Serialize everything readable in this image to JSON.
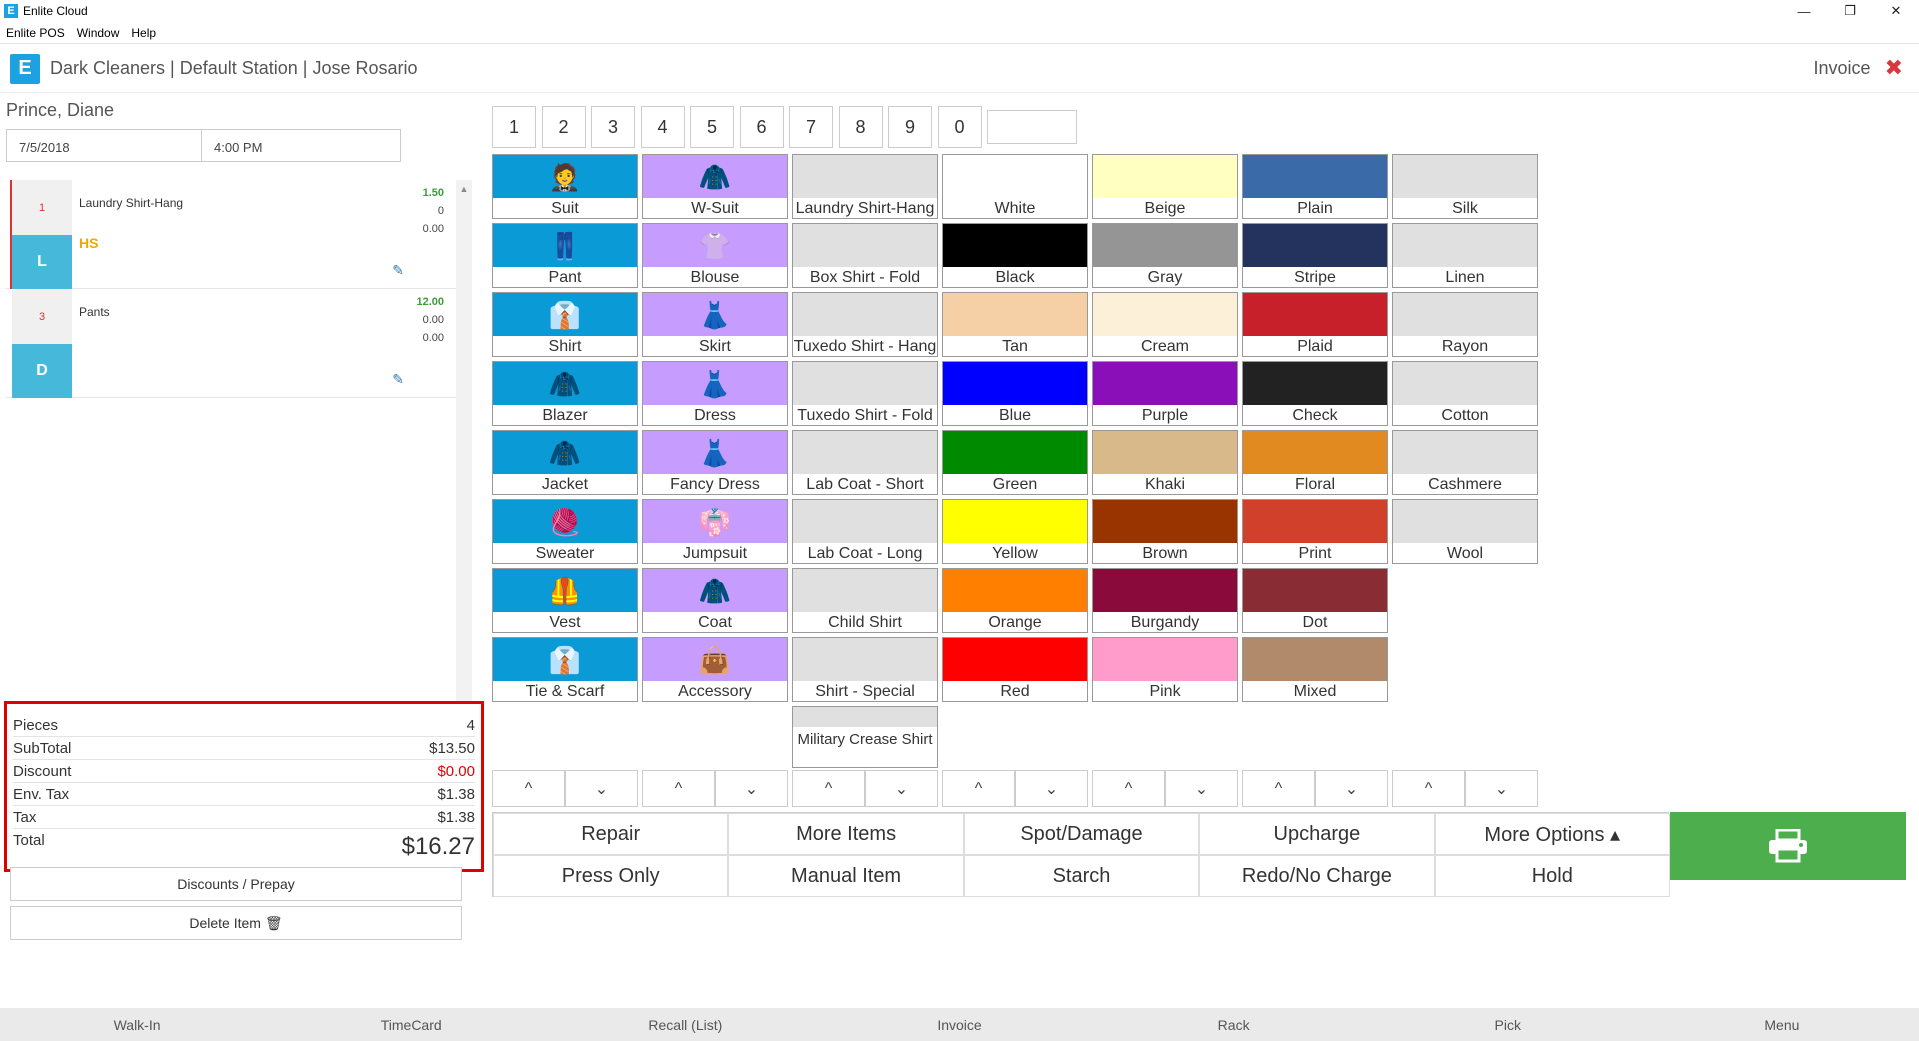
{
  "window": {
    "title": "Enlite Cloud",
    "logo_letter": "E",
    "minimize": "—",
    "restore": "❐",
    "close": "✕"
  },
  "menu": [
    "Enlite POS",
    "Window",
    "Help"
  ],
  "header": {
    "title": "Dark Cleaners | Default Station | Jose Rosario",
    "right_label": "Invoice",
    "close_glyph": "✖"
  },
  "customer": {
    "name": "Prince, Diane",
    "date": "7/5/2018",
    "time": "4:00 PM"
  },
  "items": [
    {
      "qty": "1",
      "name": "Laundry Shirt-Hang",
      "price": "1.50",
      "line2": "0",
      "line3": "0.00",
      "code": "L",
      "tag": "HS"
    },
    {
      "qty": "3",
      "name": "Pants",
      "price": "12.00",
      "line2": "0.00",
      "line3": "0.00",
      "code": "D",
      "tag": ""
    }
  ],
  "totals": {
    "pieces_label": "Pieces",
    "pieces": "4",
    "subtotal_label": "SubTotal",
    "subtotal": "$13.50",
    "discount_label": "Discount",
    "discount": "$0.00",
    "envtax_label": "Env. Tax",
    "envtax": "$1.38",
    "tax_label": "Tax",
    "tax": "$1.38",
    "total_label": "Total",
    "total": "$16.27"
  },
  "left_buttons": {
    "discounts": "Discounts / Prepay",
    "delete": "Delete Item 🗑"
  },
  "numpad": [
    "1",
    "2",
    "3",
    "4",
    "5",
    "6",
    "7",
    "8",
    "9",
    "0"
  ],
  "garments": [
    {
      "label": "Suit",
      "icon": "🤵"
    },
    {
      "label": "Pant",
      "icon": "👖"
    },
    {
      "label": "Shirt",
      "icon": "👔"
    },
    {
      "label": "Blazer",
      "icon": "🧥"
    },
    {
      "label": "Jacket",
      "icon": "🧥"
    },
    {
      "label": "Sweater",
      "icon": "🧶"
    },
    {
      "label": "Vest",
      "icon": "🦺"
    },
    {
      "label": "Tie & Scarf",
      "icon": "👔"
    }
  ],
  "womens": [
    {
      "label": "W-Suit",
      "icon": "🧥"
    },
    {
      "label": "Blouse",
      "icon": "👚"
    },
    {
      "label": "Skirt",
      "icon": "👗"
    },
    {
      "label": "Dress",
      "icon": "👗"
    },
    {
      "label": "Fancy Dress",
      "icon": "👗"
    },
    {
      "label": "Jumpsuit",
      "icon": "👘"
    },
    {
      "label": "Coat",
      "icon": "🧥"
    },
    {
      "label": "Accessory",
      "icon": "👜"
    }
  ],
  "shirts": [
    "Laundry Shirt-Hang",
    "Box Shirt - Fold",
    "Tuxedo Shirt - Hang",
    "Tuxedo Shirt - Fold",
    "Lab Coat - Short",
    "Lab Coat - Long",
    "Child Shirt",
    "Shirt - Special",
    "Military Crease Shirt"
  ],
  "colors1": [
    {
      "label": "White",
      "color": "#ffffff"
    },
    {
      "label": "Black",
      "color": "#000000"
    },
    {
      "label": "Tan",
      "color": "#f5cfa6"
    },
    {
      "label": "Blue",
      "color": "#0000ff"
    },
    {
      "label": "Green",
      "color": "#008a00"
    },
    {
      "label": "Yellow",
      "color": "#ffff00"
    },
    {
      "label": "Orange",
      "color": "#ff8000"
    },
    {
      "label": "Red",
      "color": "#ff0000"
    }
  ],
  "colors2": [
    {
      "label": "Beige",
      "color": "#ffffc2"
    },
    {
      "label": "Gray",
      "color": "#959595"
    },
    {
      "label": "Cream",
      "color": "#fdf0d8"
    },
    {
      "label": "Purple",
      "color": "#8a0fb8"
    },
    {
      "label": "Khaki",
      "color": "#d8b98a"
    },
    {
      "label": "Brown",
      "color": "#993300"
    },
    {
      "label": "Burgandy",
      "color": "#8a0a3c"
    },
    {
      "label": "Pink",
      "color": "#ff9ccc"
    }
  ],
  "patterns": [
    {
      "label": "Plain",
      "color": "#3a6aa8"
    },
    {
      "label": "Stripe",
      "color": "#24335e"
    },
    {
      "label": "Plaid",
      "color": "#c8202a"
    },
    {
      "label": "Check",
      "color": "#222222"
    },
    {
      "label": "Floral",
      "color": "#e08a20"
    },
    {
      "label": "Print",
      "color": "#d0402a"
    },
    {
      "label": "Dot",
      "color": "#8a2c34"
    },
    {
      "label": "Mixed",
      "color": "#b08a6a"
    }
  ],
  "fabrics": [
    "Silk",
    "Linen",
    "Rayon",
    "Cotton",
    "Cashmere",
    "Wool"
  ],
  "arrows": {
    "up": "^",
    "down": "⌄"
  },
  "actions": [
    "Repair",
    "More Items",
    "Spot/Damage",
    "Upcharge",
    "More Options ▴",
    "Press Only",
    "Manual Item",
    "Starch",
    "Redo/No Charge",
    "Hold"
  ],
  "footer": [
    "Walk-In",
    "TimeCard",
    "Recall (List)",
    "Invoice",
    "Rack",
    "Pick",
    "Menu"
  ],
  "colors": {
    "garment_bg": "#0a9ad6",
    "womens_bg": "#c79cff",
    "accent": "#1da1e0",
    "print_green": "#4cae4c"
  }
}
